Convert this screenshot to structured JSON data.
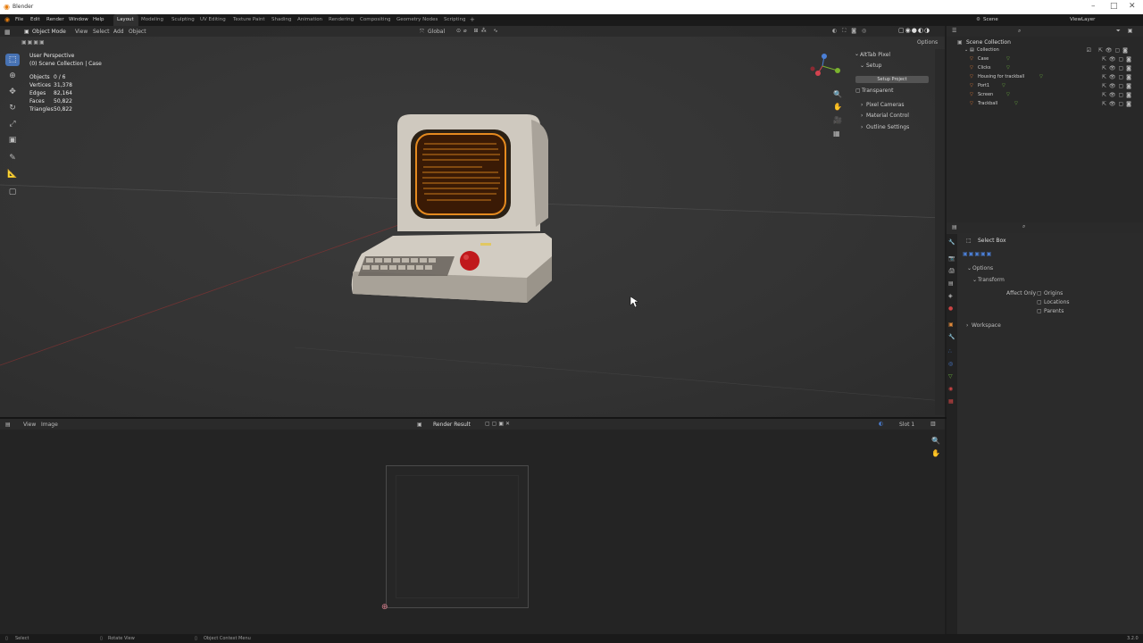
{
  "window": {
    "title": "Blender"
  },
  "menu": [
    "File",
    "Edit",
    "Render",
    "Window",
    "Help"
  ],
  "workspaces": [
    "Layout",
    "Modeling",
    "Sculpting",
    "UV Editing",
    "Texture Paint",
    "Shading",
    "Animation",
    "Rendering",
    "Compositing",
    "Geometry Nodes",
    "Scripting"
  ],
  "active_workspace": "Layout",
  "scene": "Scene",
  "view_layer": "ViewLayer",
  "viewport": {
    "mode": "Object Mode",
    "header_menus": [
      "View",
      "Select",
      "Add",
      "Object"
    ],
    "orientation": "Global",
    "options": "Options",
    "perspective": "User Perspective",
    "collection_info": "(0) Scene Collection | Case",
    "stats": [
      {
        "label": "Objects",
        "value": "0 / 6"
      },
      {
        "label": "Vertices",
        "value": "31,378"
      },
      {
        "label": "Edges",
        "value": "82,164"
      },
      {
        "label": "Faces",
        "value": "50,822"
      },
      {
        "label": "Triangles",
        "value": "50,822"
      }
    ]
  },
  "npanel": {
    "title": "AltTab Pixel",
    "setup": "Setup",
    "setup_button": "Setup Project",
    "transparent": "Transparent",
    "sections": [
      "Pixel Cameras",
      "Material Control",
      "Outline Settings"
    ]
  },
  "image_editor": {
    "menus": [
      "View",
      "Image"
    ],
    "image_name": "Render Result",
    "slot": "Slot 1"
  },
  "outliner": {
    "root": "Scene Collection",
    "collection": "Collection",
    "items": [
      "Case",
      "Clicks",
      "Housing for trackball",
      "Port1",
      "Screen",
      "Trackball"
    ]
  },
  "properties": {
    "tool": "Select Box",
    "options": "Options",
    "transform": "Transform",
    "affect_only": "Affect Only",
    "checks": [
      "Origins",
      "Locations",
      "Parents"
    ],
    "workspace": "Workspace"
  },
  "status": [
    "Select",
    "Rotate View",
    "Object Context Menu"
  ],
  "version": "3.2.0",
  "colors": {
    "accent": "#4772b3",
    "screen_glow": "#e58a1f",
    "trackball": "#c0191c"
  }
}
